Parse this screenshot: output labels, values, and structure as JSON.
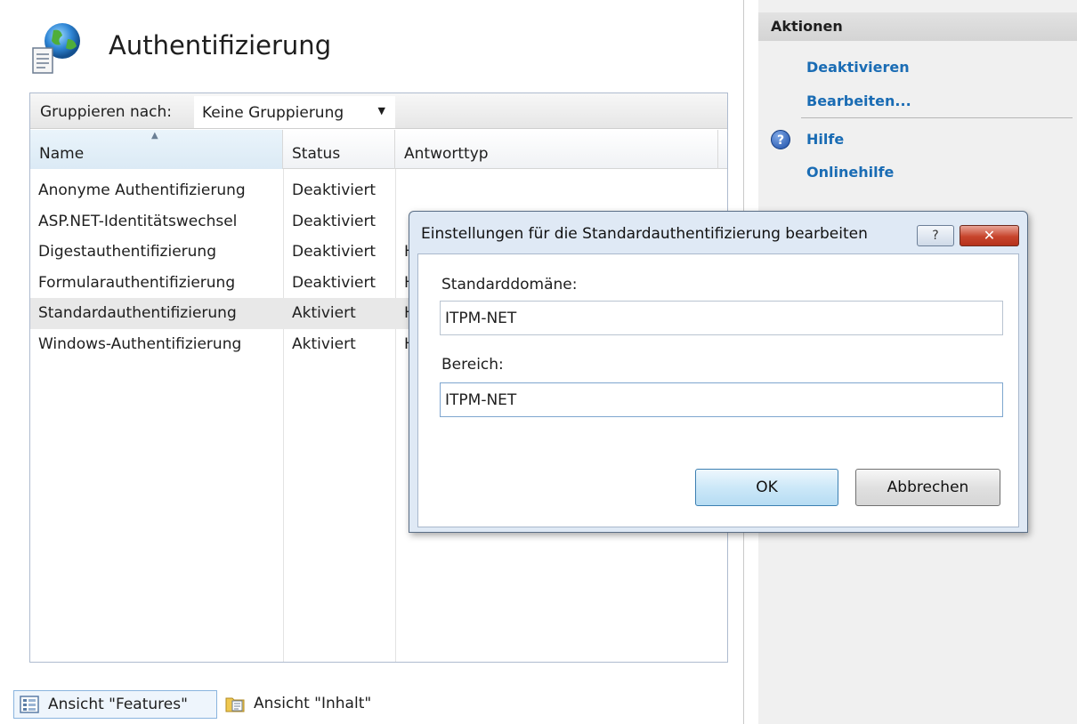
{
  "page": {
    "title": "Authentifizierung"
  },
  "groupbar": {
    "label": "Gruppieren nach:",
    "selected": "Keine Gruppierung"
  },
  "columns": {
    "name": "Name",
    "status": "Status",
    "type": "Antworttyp"
  },
  "rows": [
    {
      "name": "Anonyme Authentifizierung",
      "status": "Deaktiviert",
      "type": ""
    },
    {
      "name": "ASP.NET-Identitätswechsel",
      "status": "Deaktiviert",
      "type": ""
    },
    {
      "name": "Digestauthentifizierung",
      "status": "Deaktiviert",
      "type": "H"
    },
    {
      "name": "Formularauthentifizierung",
      "status": "Deaktiviert",
      "type": "H"
    },
    {
      "name": "Standardauthentifizierung",
      "status": "Aktiviert",
      "type": "H"
    },
    {
      "name": "Windows-Authentifizierung",
      "status": "Aktiviert",
      "type": "H"
    }
  ],
  "selected_row_index": 4,
  "view_bar": {
    "features": "Ansicht \"Features\"",
    "content": "Ansicht \"Inhalt\""
  },
  "actions": {
    "title": "Aktionen",
    "deactivate": "Deaktivieren",
    "edit": "Bearbeiten...",
    "help": "Hilfe",
    "online_help": "Onlinehilfe"
  },
  "dialog": {
    "title": "Einstellungen für die Standardauthentifizierung bearbeiten",
    "help_button": "?",
    "close_button": "✕",
    "domain_label": "Standarddomäne:",
    "domain_value": "ITPM-NET",
    "realm_label": "Bereich:",
    "realm_value": "ITPM-NET",
    "ok_label": "OK",
    "cancel_label": "Abbrechen"
  },
  "colors": {
    "link": "#1a6cb4",
    "selected_row": "#e8e8e8",
    "dialog_frame": "#dfe9f5",
    "close_button": "#c7442c"
  },
  "icons": [
    "authentication-globe-icon",
    "features-view-icon",
    "content-view-icon",
    "help-icon",
    "dropdown-arrow-icon",
    "sort-ascending-icon"
  ]
}
